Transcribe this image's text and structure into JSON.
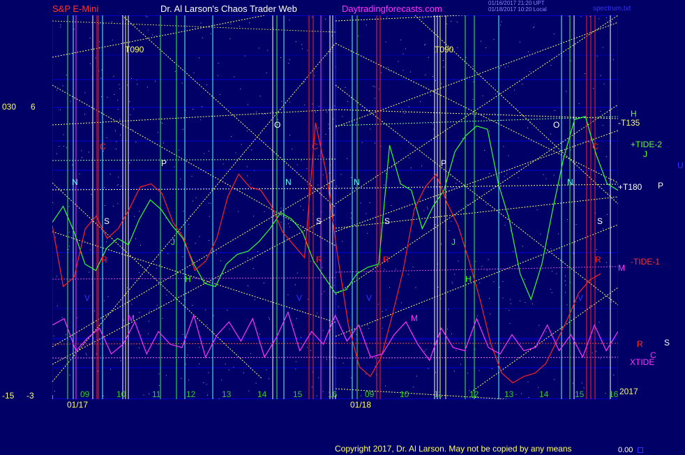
{
  "header": {
    "symbol": "S&P E-Mini",
    "title": "Dr. Al Larson's Chaos Trader Web",
    "site": "Daytradingforecasts.com",
    "stamp1": "01/16/2017 21:20 UPT",
    "stamp2": "01/18/2017 10:20 Local",
    "file": "spectrum.txt"
  },
  "footer": {
    "copyright": "Copyright 2017, Dr. Al Larson. May not be copied by any means",
    "value": "0.00"
  },
  "axis": {
    "y_top": [
      "030",
      "6"
    ],
    "y_bottom": [
      "-15",
      "-3"
    ],
    "year": "2017"
  },
  "colors": {
    "bg": "#000066",
    "grid": "#0000cc",
    "green": "#33ff33",
    "red": "#ff2222",
    "magenta": "#ff33ff",
    "yellow": "#ffff66",
    "cyan": "#66ffff",
    "white": "#ffffff"
  },
  "chart_data": {
    "type": "line",
    "x_dates": [
      "01/17",
      "01/18"
    ],
    "hour_ticks": [
      "09",
      "10",
      "11",
      "12",
      "13",
      "14",
      "15",
      "16",
      "09",
      "10",
      "11",
      "12",
      "13",
      "14",
      "15",
      "16"
    ],
    "y_range": [
      -3,
      6
    ],
    "series": [
      {
        "name": "+TIDE-2",
        "values": [
          2.4,
          2.9,
          2.1,
          1.1,
          0.9,
          1.6,
          1.9,
          1.7,
          2.5,
          3.1,
          2.8,
          2.3,
          1.9,
          1.1,
          0.5,
          0.4,
          1.1,
          1.4,
          1.5,
          1.8,
          2.2,
          2.7,
          2.5,
          2.1,
          1.2,
          0.7,
          0.2,
          0.3,
          0.8,
          1.0,
          1.1,
          4.8,
          3.6,
          3.4,
          2.2,
          2.9,
          3.4,
          4.6,
          5.1,
          5.4,
          5.3,
          3.6,
          2.5,
          0.8,
          0.0,
          1.1,
          2.8,
          4.4,
          5.6,
          5.7,
          4.5,
          3.6,
          3.4
        ]
      },
      {
        "name": "-TIDE-1",
        "values": [
          2.3,
          0.4,
          0.7,
          2.2,
          2.6,
          1.9,
          2.2,
          2.8,
          3.5,
          3.6,
          3.3,
          2.4,
          1.9,
          0.9,
          1.2,
          1.9,
          3.2,
          3.9,
          3.5,
          3.4,
          2.9,
          2.1,
          1.7,
          1.3,
          5.5,
          3.9,
          1.4,
          -0.8,
          -2.1,
          -2.4,
          -1.8,
          -0.5,
          0.9,
          2.8,
          3.5,
          3.9,
          3.0,
          2.3,
          1.2,
          0.0,
          -1.4,
          -2.3,
          -2.6,
          -2.4,
          -2.3,
          -2.0,
          -1.3,
          -0.6,
          0.2,
          0.6,
          0.8
        ]
      },
      {
        "name": "XTIDE",
        "values": [
          -0.8,
          -0.6,
          -1.6,
          -1.2,
          -0.9,
          -1.7,
          -1.4,
          -0.7,
          -1.7,
          -1.0,
          -1.4,
          -1.5,
          -0.5,
          -1.8,
          -1.1,
          -0.7,
          -1.3,
          -0.6,
          -1.8,
          -1.2,
          -0.4,
          -1.6,
          -1.0,
          -1.4,
          -0.5,
          -1.3,
          -0.8,
          -1.8,
          -1.7,
          -1.1,
          -0.7,
          -1.4,
          -1.9,
          -0.9,
          -1.5,
          -1.6,
          -0.6,
          -1.5,
          -1.7,
          -1.1,
          -1.6,
          -1.5,
          -0.8,
          -1.6,
          -1.1,
          -1.8,
          -0.8,
          -1.6,
          -1.0
        ]
      }
    ],
    "series_labels": [
      "H",
      "-T135",
      "+TIDE-2",
      "J",
      "+T180",
      "-TIDE-1",
      "M",
      "XTIDE"
    ],
    "right_letters": [
      "U",
      "P",
      "R",
      "C",
      "S"
    ],
    "line_labels": [
      "T090",
      "T090"
    ],
    "letters": [
      {
        "t": "O"
      },
      {
        "t": "O"
      },
      {
        "t": "P"
      },
      {
        "t": "P"
      },
      {
        "t": "N"
      },
      {
        "t": "N"
      },
      {
        "t": "N"
      },
      {
        "t": "N"
      },
      {
        "t": "S"
      },
      {
        "t": "S"
      },
      {
        "t": "S"
      },
      {
        "t": "S"
      },
      {
        "t": "J"
      },
      {
        "t": "J"
      },
      {
        "t": "H"
      },
      {
        "t": "H"
      },
      {
        "t": "R"
      },
      {
        "t": "R"
      },
      {
        "t": "R"
      },
      {
        "t": "R"
      },
      {
        "t": "M"
      },
      {
        "t": "M"
      },
      {
        "t": "V"
      },
      {
        "t": "V"
      },
      {
        "t": "V"
      },
      {
        "t": "V"
      },
      {
        "t": "C"
      },
      {
        "t": "C"
      },
      {
        "t": "C"
      }
    ]
  }
}
